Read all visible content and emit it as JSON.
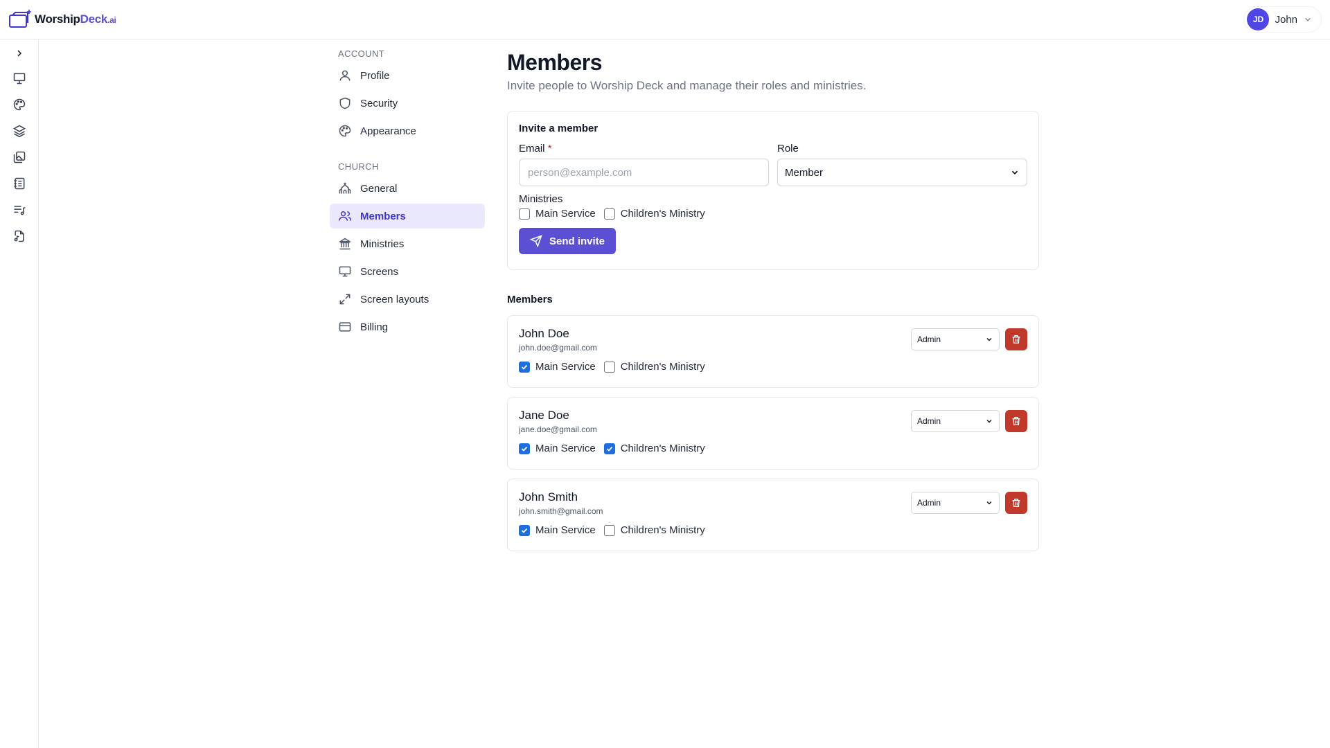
{
  "header": {
    "logo": {
      "part1": "Worship",
      "part2": "Deck",
      "part3": ".ai"
    },
    "user": {
      "initials": "JD",
      "name": "John"
    }
  },
  "rail": {
    "icons": [
      "chevron-right-icon",
      "presentation-icon",
      "palette-icon",
      "layers-icon",
      "images-icon",
      "notebook-icon",
      "playlist-icon",
      "file-music-icon"
    ]
  },
  "settings_nav": {
    "account_label": "ACCOUNT",
    "account_items": [
      {
        "label": "Profile",
        "icon": "user-icon"
      },
      {
        "label": "Security",
        "icon": "shield-icon"
      },
      {
        "label": "Appearance",
        "icon": "palette-icon"
      }
    ],
    "church_label": "CHURCH",
    "church_items": [
      {
        "label": "General",
        "icon": "church-icon"
      },
      {
        "label": "Members",
        "icon": "users-icon",
        "active": true
      },
      {
        "label": "Ministries",
        "icon": "landmark-icon"
      },
      {
        "label": "Screens",
        "icon": "monitor-icon"
      },
      {
        "label": "Screen layouts",
        "icon": "expand-icon"
      },
      {
        "label": "Billing",
        "icon": "credit-card-icon"
      }
    ]
  },
  "main": {
    "title": "Members",
    "subtitle": "Invite people to Worship Deck and manage their roles and ministries.",
    "invite": {
      "title": "Invite a member",
      "email_label": "Email",
      "email_required": "*",
      "email_placeholder": "person@example.com",
      "role_label": "Role",
      "role_value": "Member",
      "ministries_label": "Ministries",
      "ministries": [
        {
          "label": "Main Service",
          "checked": false
        },
        {
          "label": "Children's Ministry",
          "checked": false
        }
      ],
      "send_label": "Send invite"
    },
    "members_title": "Members",
    "members": [
      {
        "name": "John Doe",
        "email": "john.doe@gmail.com",
        "role": "Admin",
        "ministries": [
          {
            "label": "Main Service",
            "checked": true
          },
          {
            "label": "Children's Ministry",
            "checked": false
          }
        ]
      },
      {
        "name": "Jane Doe",
        "email": "jane.doe@gmail.com",
        "role": "Admin",
        "ministries": [
          {
            "label": "Main Service",
            "checked": true
          },
          {
            "label": "Children's Ministry",
            "checked": true
          }
        ]
      },
      {
        "name": "John Smith",
        "email": "john.smith@gmail.com",
        "role": "Admin",
        "ministries": [
          {
            "label": "Main Service",
            "checked": true
          },
          {
            "label": "Children's Ministry",
            "checked": false
          }
        ]
      }
    ]
  },
  "colors": {
    "accent": "#5b4fd4",
    "checkbox": "#1d6fe0",
    "danger": "#c0392b"
  }
}
